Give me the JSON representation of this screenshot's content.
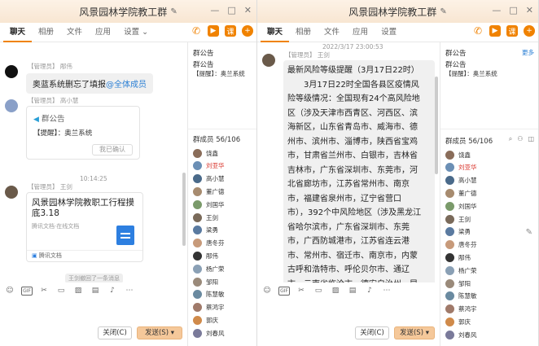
{
  "colors": {
    "accent": "#f08200",
    "link": "#2a7fd4",
    "red_name": "#d9342b",
    "send_bg": "#f5c89a"
  },
  "left": {
    "title": "风景园林学院教工群",
    "tabs": [
      {
        "label": "聊天",
        "active": true
      },
      {
        "label": "相册",
        "active": false
      },
      {
        "label": "文件",
        "active": false
      },
      {
        "label": "应用",
        "active": false
      },
      {
        "label": "设置",
        "active": false
      }
    ],
    "settings_arrow": "⌄",
    "messages": {
      "m1": {
        "sender": "【管理员】 邴伟",
        "text": "奥蓝系统删忘了填报",
        "mention": "@全体成员"
      },
      "m2": {
        "sender": "【管理员】 高小慧",
        "card_title": "群公告",
        "card_text": "【提醒】：奥兰系统",
        "card_button": "我已确认"
      },
      "time": "10:14:25",
      "m3": {
        "sender": "【管理员】 王剑",
        "doc_title": "风景园林学院教职工行程摸底3.18",
        "doc_sub": "腾讯文档·在线文档",
        "doc_footer": "腾讯文档"
      },
      "recall": "王剑撤回了一条消息"
    },
    "side": {
      "announce_head": "群公告",
      "announce_head2": "群公告",
      "announce_text": "【提醒】：奥兰系统",
      "members_head": "群成员 56/106",
      "members": [
        {
          "name": "饶鑫",
          "red": false,
          "color": "#8a6d5a"
        },
        {
          "name": "刘亚华",
          "red": true,
          "color": "#6b8fb5"
        },
        {
          "name": "高小慧",
          "red": false,
          "color": "#4a6a8a"
        },
        {
          "name": "董广德",
          "red": false,
          "color": "#a78b6f"
        },
        {
          "name": "刘国华",
          "red": false,
          "color": "#7a9a6a"
        },
        {
          "name": "王剑",
          "red": false,
          "color": "#7a6a5a"
        },
        {
          "name": "梁勇",
          "red": false,
          "color": "#5a7aa0"
        },
        {
          "name": "唐冬芬",
          "red": false,
          "color": "#c79a7a"
        },
        {
          "name": "邴伟",
          "red": false,
          "color": "#333333"
        },
        {
          "name": "杨广荣",
          "red": false,
          "color": "#8aa0b5"
        },
        {
          "name": "邹阳",
          "red": false,
          "color": "#9a8a7a"
        },
        {
          "name": "陈慧敏",
          "red": false,
          "color": "#6a8aa0"
        },
        {
          "name": "蔡鸿宇",
          "red": false,
          "color": "#a07a6a"
        },
        {
          "name": "郭庆",
          "red": false,
          "color": "#d08a4a"
        },
        {
          "name": "刘春风",
          "red": false,
          "color": "#7a7a9a"
        }
      ]
    },
    "close_label": "关闭(C)",
    "send_label": "发送(S)"
  },
  "right": {
    "title": "风景园林学院教工群",
    "tabs": [
      {
        "label": "聊天",
        "active": true
      },
      {
        "label": "相册",
        "active": false
      },
      {
        "label": "文件",
        "active": false
      },
      {
        "label": "应用",
        "active": false
      },
      {
        "label": "设置",
        "active": false
      }
    ],
    "timestamp": "2022/3/17 23:00:53",
    "sender": "【管理员】 王剑",
    "lines": [
      "最新风险等级提醒（3月17日22时）",
      "　　3月17日22时全国各县区疫情风",
      "险等级情况：全国现有24个高风险地",
      "区（涉及天津市西青区、河西区、滨",
      "海新区，山东省青岛市、威海市、德",
      "州市、滨州市、淄博市，陕西省宝鸡",
      "市，甘肃省兰州市、白银市，吉林省",
      "吉林市，广东省深圳市、东莞市，河",
      "北省廊坊市，江苏省常州市、南京",
      "市，福建省泉州市，辽宁省营口",
      "市），392个中风险地区（涉及黑龙江",
      "省哈尔滨市，广东省深圳市、东莞",
      "市，广西防城港市，江苏省连云港",
      "市、常州市、宿迁市、南京市，内蒙",
      "古呼和浩特市、呼伦贝尔市、通辽",
      "市，云南省临沧市、德宏自治州、昆"
    ],
    "side": {
      "announce_head": "群公告",
      "more": "更多",
      "announce_head2": "群公告",
      "announce_text": "【提醒】：奥兰系统",
      "members_head": "群成员 56/106",
      "members": [
        {
          "name": "饶鑫",
          "red": false,
          "color": "#8a6d5a"
        },
        {
          "name": "刘亚华",
          "red": true,
          "color": "#6b8fb5"
        },
        {
          "name": "高小慧",
          "red": false,
          "color": "#4a6a8a"
        },
        {
          "name": "董广德",
          "red": false,
          "color": "#a78b6f"
        },
        {
          "name": "刘国华",
          "red": false,
          "color": "#7a9a6a"
        },
        {
          "name": "王剑",
          "red": false,
          "color": "#7a6a5a"
        },
        {
          "name": "梁勇",
          "red": false,
          "color": "#5a7aa0"
        },
        {
          "name": "唐冬芬",
          "red": false,
          "color": "#c79a7a"
        },
        {
          "name": "邴伟",
          "red": false,
          "color": "#333333"
        },
        {
          "name": "杨广荣",
          "red": false,
          "color": "#8aa0b5"
        },
        {
          "name": "邹阳",
          "red": false,
          "color": "#9a8a7a"
        },
        {
          "name": "陈慧敏",
          "red": false,
          "color": "#6a8aa0"
        },
        {
          "name": "蔡鸿宇",
          "red": false,
          "color": "#a07a6a"
        },
        {
          "name": "郭庆",
          "red": false,
          "color": "#d08a4a"
        },
        {
          "name": "刘春风",
          "red": false,
          "color": "#7a7a9a"
        }
      ]
    },
    "close_label": "关闭(C)",
    "send_label": "发送(S)"
  }
}
